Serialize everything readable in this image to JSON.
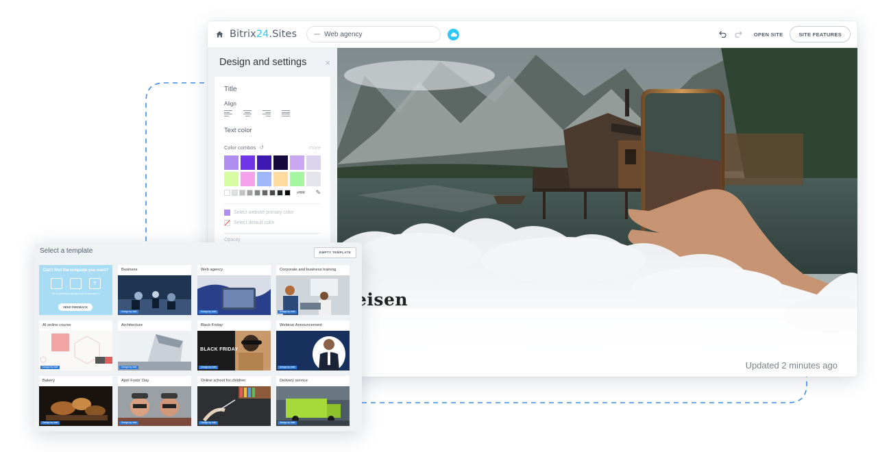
{
  "colors": {
    "accent": "#2fc6f6",
    "badge": "#2f7bd6",
    "dashed_connector": "#3b8ee8",
    "panel_bg": "#eef2f4"
  },
  "editor": {
    "topbar": {
      "home_icon": "home-icon",
      "logo_prefix": "Bitrix",
      "logo_accent": "24",
      "logo_suffix": ".Sites",
      "site_select_value": "Web agency",
      "cloud_icon": "cloud-icon",
      "undo_icon": "undo-icon",
      "redo_icon": "redo-icon",
      "open_site_label": "OPEN SITE",
      "site_features_label": "SITE FEATURES"
    },
    "settings": {
      "title": "Design and settings",
      "close_glyph": "×",
      "section_title": "Title",
      "align_label": "Align",
      "align_options": [
        "align-left",
        "align-center",
        "align-right",
        "align-justify"
      ],
      "text_color_label": "Text color",
      "color_combos_label": "Color combos",
      "more_label": "more",
      "swatches": [
        "#b08ef0",
        "#7035e8",
        "#3d17b1",
        "#15083d",
        "#c9a7f0",
        "#dcd4ee",
        "#d7fca1",
        "#f2a1ea",
        "#a0b8f9",
        "#fddba0",
        "#a6f5a1",
        "#e4e4ec"
      ],
      "grays": [
        "#ffffff",
        "#e0e0e0",
        "#c2c2c2",
        "#a4a4a4",
        "#858585",
        "#666666",
        "#484848",
        "#292929",
        "#0a0a0a"
      ],
      "hex_value": "#ffffff",
      "primary_color_label": "Select website primary color",
      "default_color_label": "Select default color",
      "opacity_label": "Opacity"
    },
    "preview": {
      "hero_text": "eisen",
      "updated_label": "Updated 2 minutes ago"
    }
  },
  "picker": {
    "title": "Select a template",
    "empty_template_label": "EMPTY TEMPLATE",
    "feedback": {
      "title": "Can't find the template you want?",
      "text": "Tell us what kind of template you're interested in",
      "button_label": "SEND FEEDBACK"
    },
    "templates": [
      {
        "name": "Business",
        "badge": "Design by Intel"
      },
      {
        "name": "Web agency",
        "badge": "Design by Intel"
      },
      {
        "name": "Corporate and business training",
        "badge": "Design by Intel"
      },
      {
        "name": "AI online course",
        "badge": "Design by Intel"
      },
      {
        "name": "Architecture",
        "badge": "Design by Intel"
      },
      {
        "name": "Black Friday",
        "badge": "Design by Intel"
      },
      {
        "name": "Webinar Announcement",
        "badge": "Design by Intel"
      },
      {
        "name": "Bakery",
        "badge": "Design by Intel"
      },
      {
        "name": "April Fools' Day",
        "badge": "Design by Intel"
      },
      {
        "name": "Online school for children",
        "badge": "Design by Intel"
      },
      {
        "name": "Delivery service",
        "badge": "Design by Intel"
      }
    ],
    "black_friday_banner": "BLACK FRIDAY"
  }
}
